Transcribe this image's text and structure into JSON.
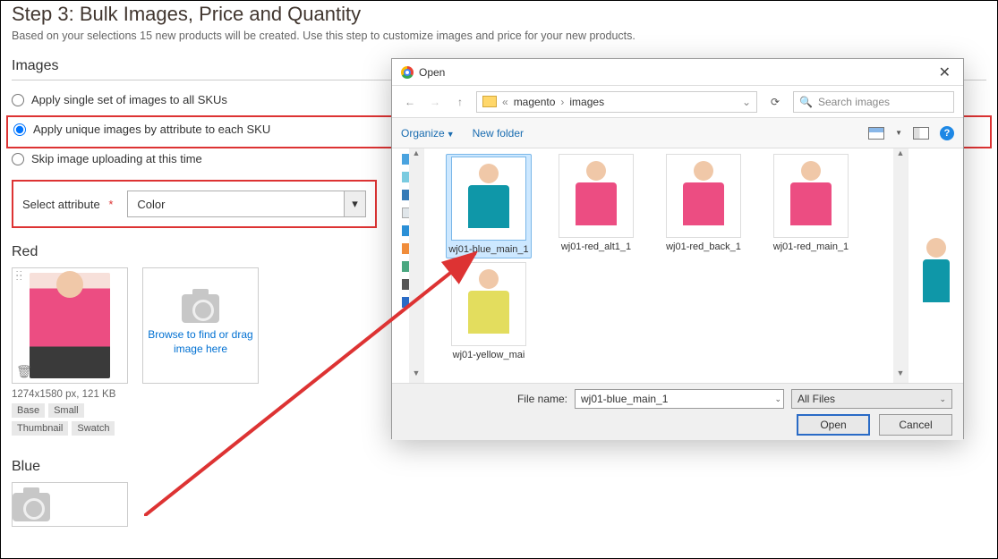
{
  "page": {
    "step_title": "Step 3: Bulk Images, Price and Quantity",
    "step_sub": "Based on your selections 15 new products will be created. Use this step to customize images and price for your new products.",
    "images_heading": "Images",
    "radios": {
      "r1": "Apply single set of images to all SKUs",
      "r2": "Apply unique images by attribute to each SKU",
      "r3": "Skip image uploading at this time"
    },
    "attr_label": "Select attribute",
    "attr_value": "Color",
    "sections": {
      "red_label": "Red",
      "blue_label": "Blue"
    },
    "browse_text": "Browse to find or drag image here",
    "thumb_meta": "1274x1580 px, 121 KB",
    "tags": {
      "base": "Base",
      "small": "Small",
      "thumbnail": "Thumbnail",
      "swatch": "Swatch"
    }
  },
  "dialog": {
    "title": "Open",
    "breadcrumb": {
      "p1": "magento",
      "p2": "images"
    },
    "search_placeholder": "Search images",
    "toolbar": {
      "organize": "Organize",
      "newfolder": "New folder"
    },
    "files": [
      {
        "name": "wj01-blue_main_1",
        "color": "blue",
        "selected": true
      },
      {
        "name": "wj01-red_alt1_1",
        "color": "pink",
        "selected": false
      },
      {
        "name": "wj01-red_back_1",
        "color": "pink",
        "selected": false
      },
      {
        "name": "wj01-red_main_1",
        "color": "pink",
        "selected": false
      },
      {
        "name": "wj01-yellow_mai",
        "color": "yellow",
        "selected": false
      }
    ],
    "filename_label": "File name:",
    "filename_value": "wj01-blue_main_1",
    "filter_label": "All Files",
    "open_btn": "Open",
    "cancel_btn": "Cancel"
  }
}
